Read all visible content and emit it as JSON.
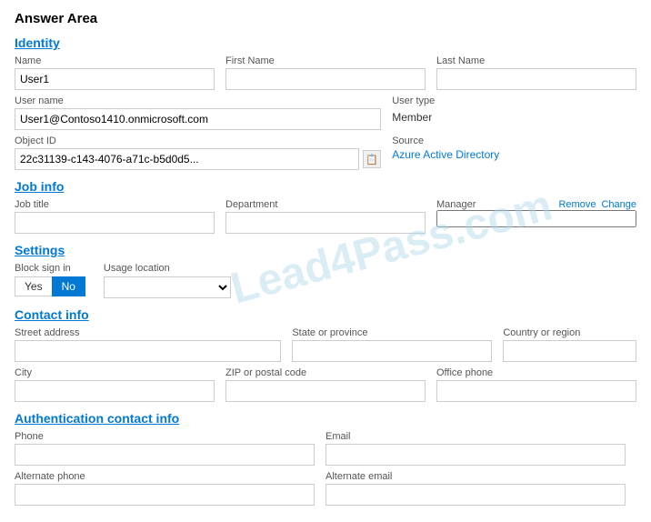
{
  "page": {
    "title": "Answer Area"
  },
  "sections": {
    "identity": {
      "label": "Identity",
      "fields": {
        "name_label": "Name",
        "name_value": "User1",
        "first_name_label": "First Name",
        "last_name_label": "Last Name",
        "username_label": "User name",
        "username_value": "User1@Contoso1410.onmicrosoft.com",
        "user_type_label": "User type",
        "user_type_value": "Member",
        "object_id_label": "Object ID",
        "object_id_value": "22c31139-c143-4076-a71c-b5d0d5...",
        "source_label": "Source",
        "source_value": "Azure Active Directory"
      }
    },
    "job_info": {
      "label": "Job info",
      "fields": {
        "job_title_label": "Job title",
        "department_label": "Department",
        "manager_label": "Manager",
        "remove_label": "Remove",
        "change_label": "Change"
      }
    },
    "settings": {
      "label": "Settings",
      "block_signin": {
        "label": "Block sign in",
        "yes_label": "Yes",
        "no_label": "No",
        "active": "No"
      },
      "usage_location": {
        "label": "Usage location"
      }
    },
    "contact_info": {
      "label": "Contact info",
      "fields": {
        "street_address_label": "Street address",
        "state_province_label": "State or province",
        "country_region_label": "Country or region",
        "city_label": "City",
        "zip_postal_label": "ZIP or postal code",
        "office_phone_label": "Office phone"
      }
    },
    "auth_contact_info": {
      "label": "Authentication contact info",
      "fields": {
        "phone_label": "Phone",
        "email_label": "Email",
        "alt_phone_label": "Alternate phone",
        "alt_email_label": "Alternate email"
      }
    }
  },
  "watermark": "Lead4Pass.com"
}
